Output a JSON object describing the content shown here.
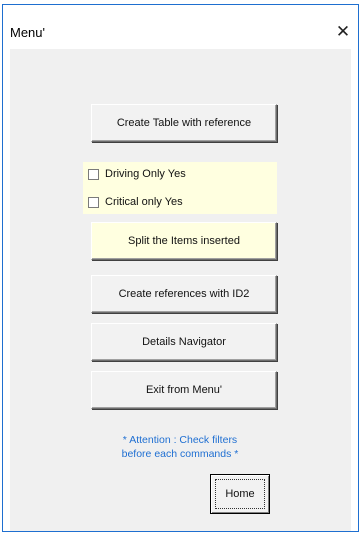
{
  "window": {
    "title": "Menu'",
    "close_glyph": "✕"
  },
  "buttons": {
    "create_table": "Create Table with reference",
    "split_items": "Split the Items inserted",
    "create_references": "Create references with ID2",
    "details_navigator": "Details Navigator",
    "exit_menu": "Exit from Menu'",
    "home": "Home"
  },
  "options": {
    "driving_only": {
      "label": "Driving Only Yes",
      "checked": false
    },
    "critical_only": {
      "label": "Critical only Yes",
      "checked": false
    }
  },
  "attention": {
    "line1": "* Attention : Check filters",
    "line2": "before each commands *"
  },
  "colors": {
    "accent_border": "#1e6fd0",
    "panel_yellow": "#ffffe0",
    "attention_text": "#1f6fd2"
  }
}
